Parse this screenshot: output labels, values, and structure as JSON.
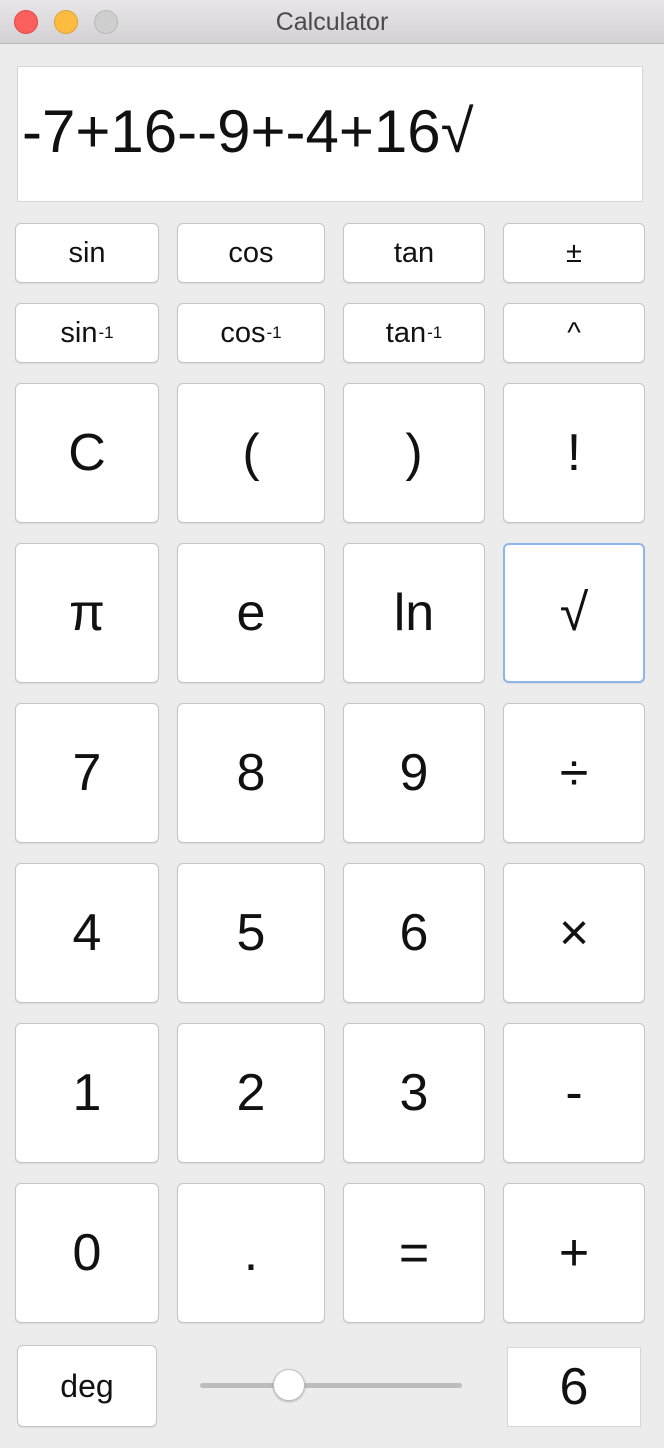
{
  "window": {
    "title": "Calculator"
  },
  "display": {
    "expression": "-7+16--9+-4+16√"
  },
  "function_row_1": {
    "sin": "sin",
    "cos": "cos",
    "tan": "tan",
    "plus_minus": "±"
  },
  "function_row_2": {
    "asin_base": "sin",
    "acos_base": "cos",
    "atan_base": "tan",
    "inverse_exponent": "-1",
    "power": "^"
  },
  "keypad": {
    "clear": "C",
    "open_paren": "(",
    "close_paren": ")",
    "factorial": "!",
    "pi": "π",
    "e": "e",
    "ln": "ln",
    "sqrt": "√",
    "seven": "7",
    "eight": "8",
    "nine": "9",
    "divide": "÷",
    "four": "4",
    "five": "5",
    "six": "6",
    "multiply": "×",
    "one": "1",
    "two": "2",
    "three": "3",
    "minus": "-",
    "zero": "0",
    "decimal": ".",
    "equals": "=",
    "plus": "+"
  },
  "bottom": {
    "angle_mode": "deg",
    "precision_value": "6",
    "slider_fraction": 0.34
  },
  "colors": {
    "focus_ring": "#8fb6e6",
    "close": "#fc605c",
    "minimize": "#fdbc40",
    "zoom": "#cfcfcf"
  }
}
